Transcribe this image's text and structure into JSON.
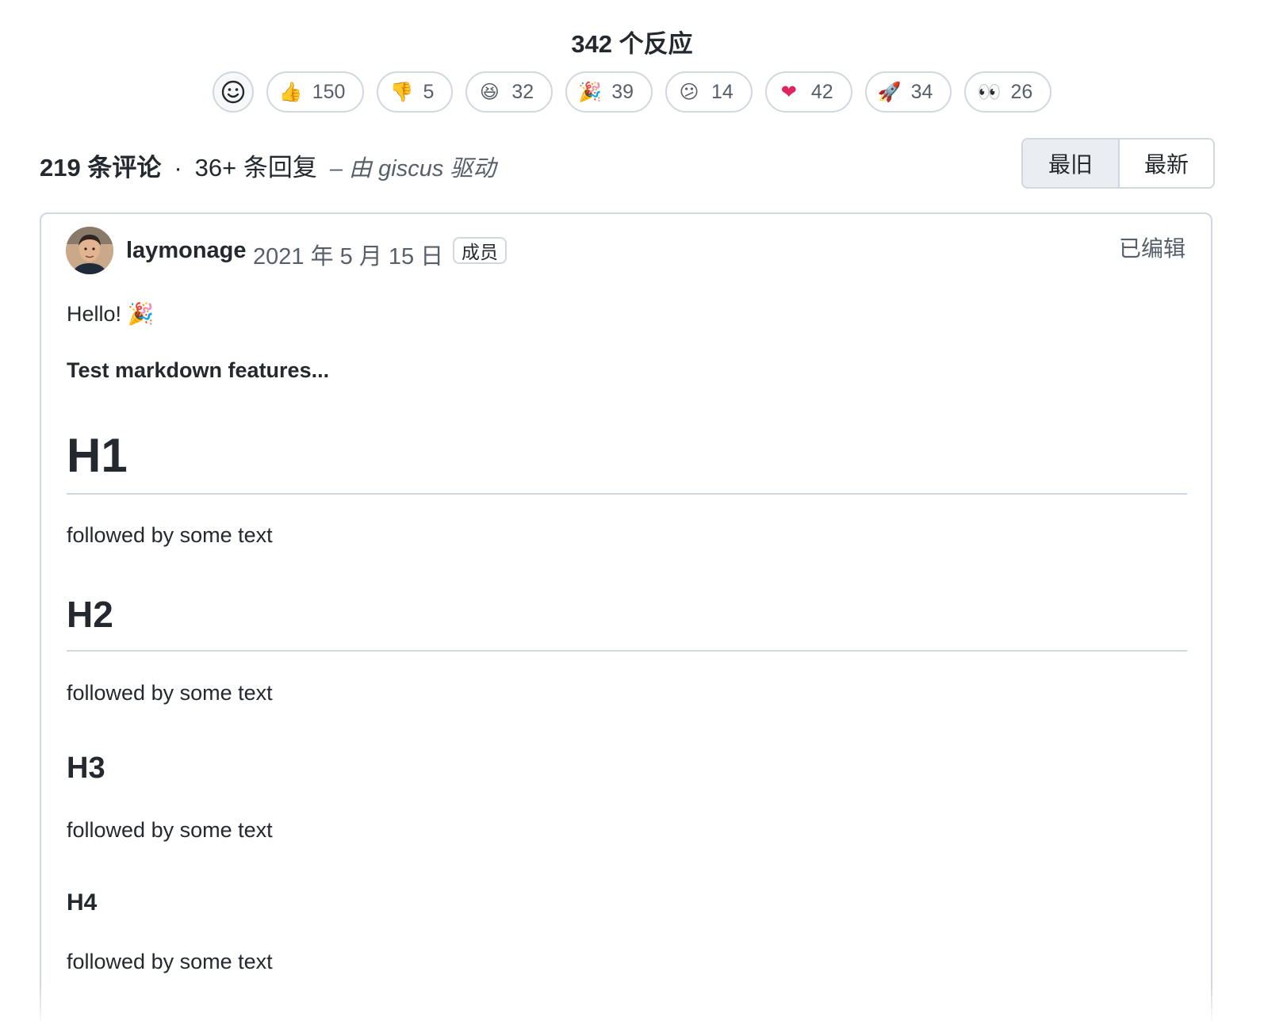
{
  "reactions": {
    "title": "342 个反应",
    "items": [
      {
        "emoji": "👍",
        "count": "150"
      },
      {
        "emoji": "👎",
        "count": "5"
      },
      {
        "emoji": "😆",
        "count": "32"
      },
      {
        "emoji": "🎉",
        "count": "39"
      },
      {
        "emoji": "😕",
        "count": "14"
      },
      {
        "emoji": "❤",
        "count": "42"
      },
      {
        "emoji": "🚀",
        "count": "34"
      },
      {
        "emoji": "👀",
        "count": "26"
      }
    ]
  },
  "comments_header": {
    "count": "219 条评论",
    "separator": "·",
    "replies": "36+ 条回复",
    "powered_by": "– 由 giscus 驱动"
  },
  "sort": {
    "oldest": "最旧",
    "newest": "最新"
  },
  "comment": {
    "author": "laymonage",
    "date": "2021 年 5 月 15 日",
    "badge": "成员",
    "edited": "已编辑",
    "hello": "Hello! 🎉",
    "bold_line": "Test markdown features...",
    "h1": "H1",
    "h2": "H2",
    "h3": "H3",
    "h4": "H4",
    "text1": "followed by some text",
    "text2": "followed by some text",
    "text3": "followed by some text",
    "text4": "followed by some text"
  }
}
